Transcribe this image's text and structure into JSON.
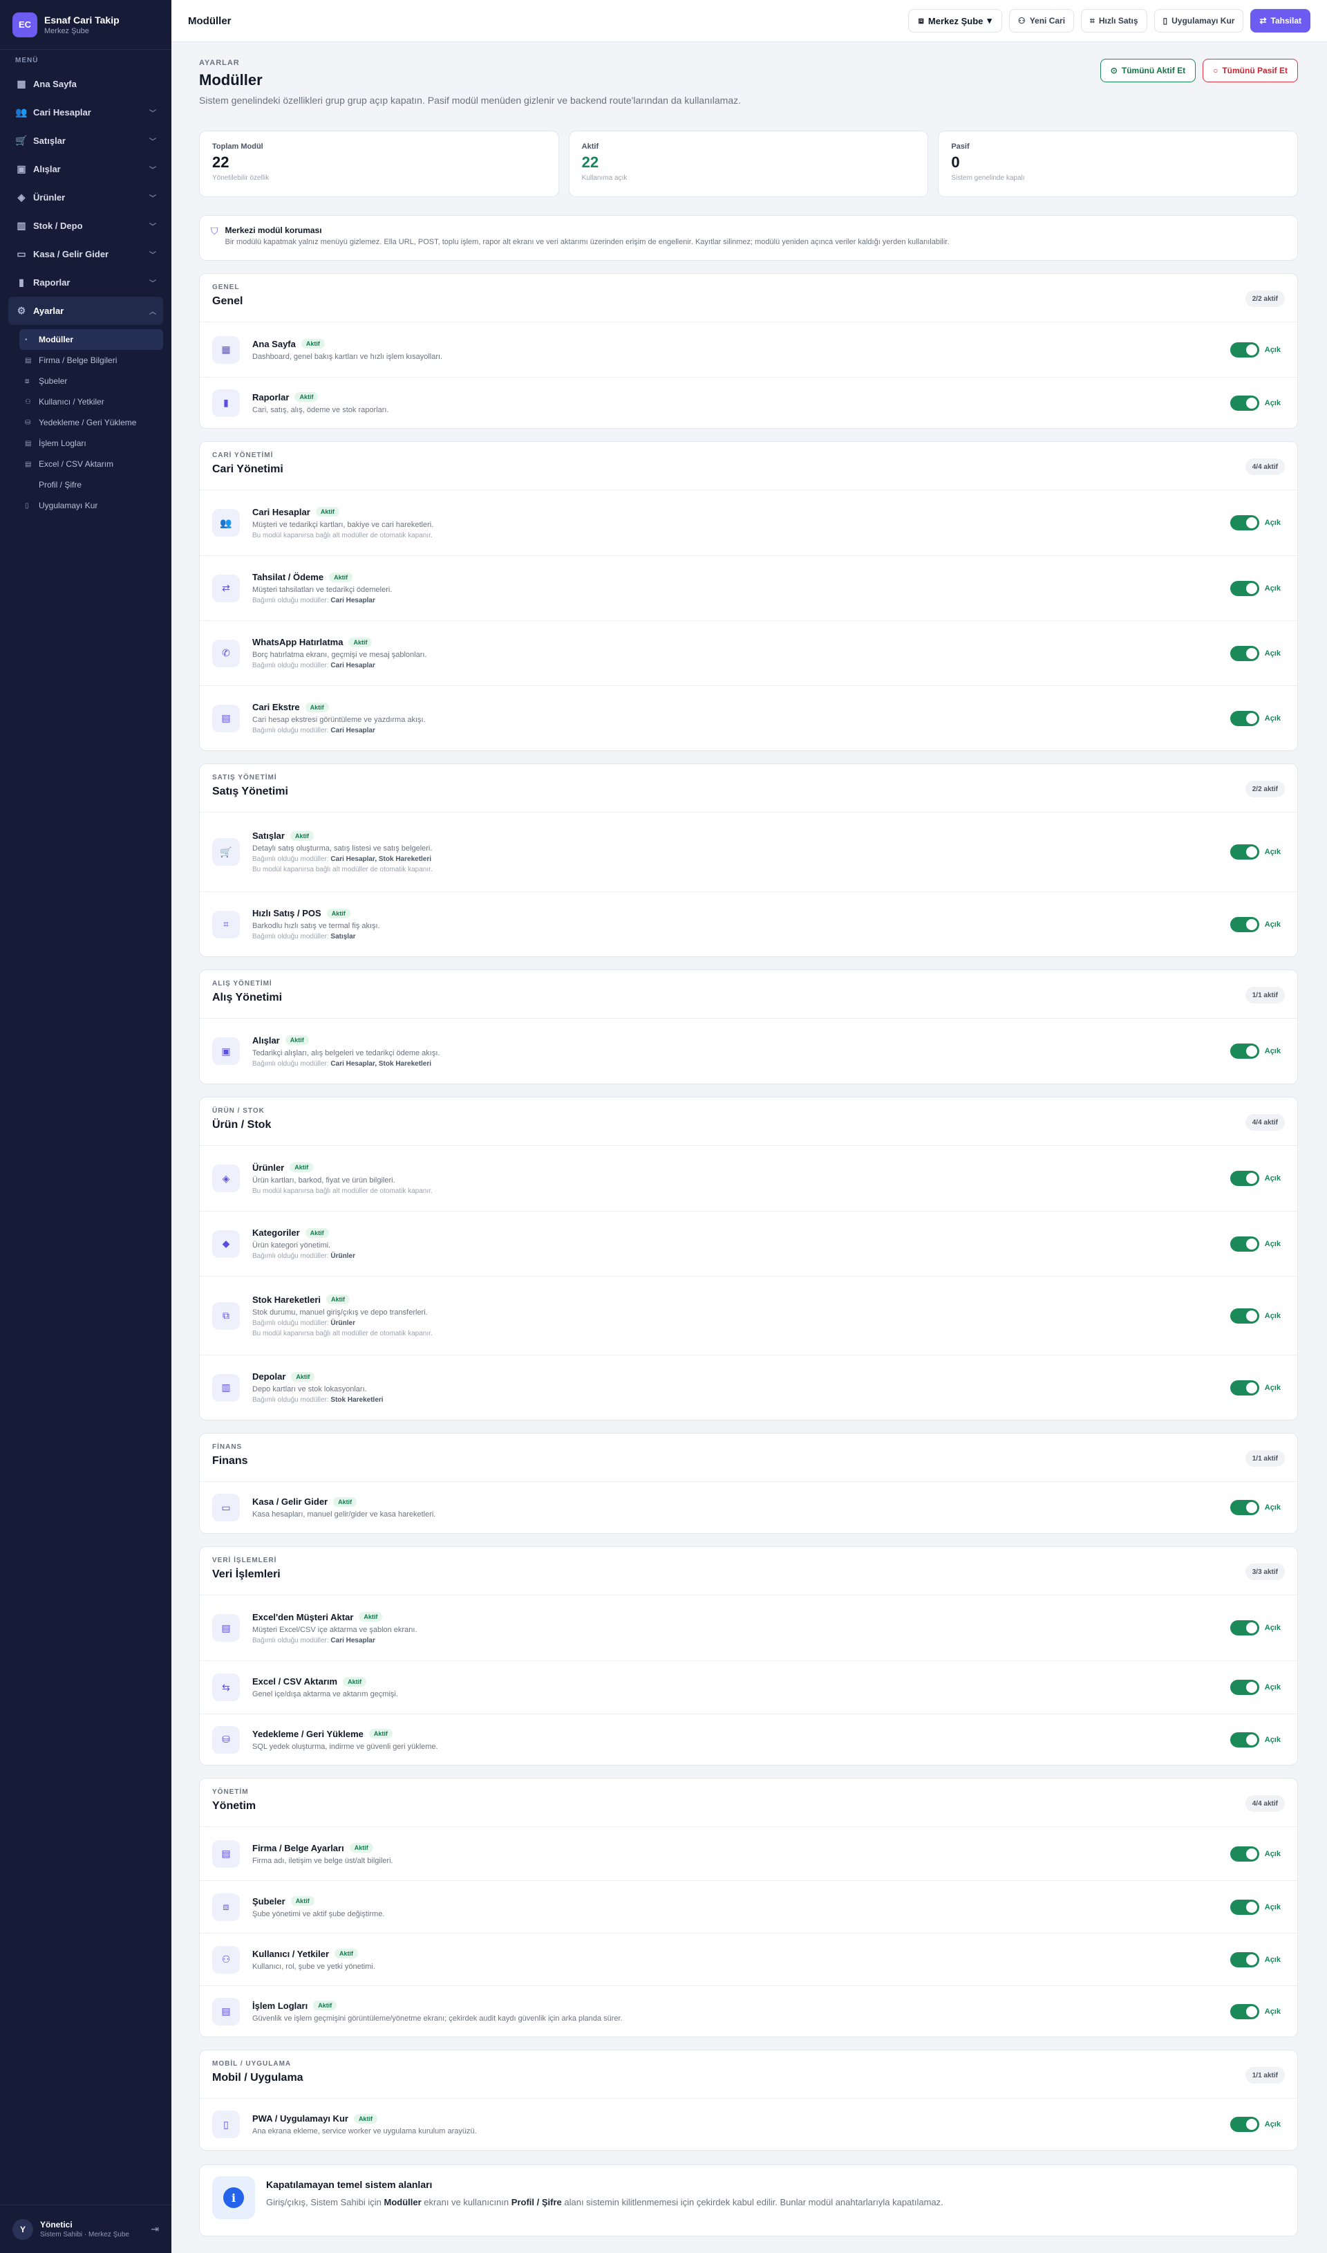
{
  "brand": {
    "logo": "EC",
    "name": "Esnaf Cari Takip",
    "sub": "Merkez Şube"
  },
  "sidebar": {
    "menu_title": "MENÜ",
    "items": [
      {
        "label": "Ana Sayfa",
        "icon": "home-icon"
      },
      {
        "label": "Cari Hesaplar",
        "icon": "users-icon"
      },
      {
        "label": "Satışlar",
        "icon": "cart-icon"
      },
      {
        "label": "Alışlar",
        "icon": "bag-icon"
      },
      {
        "label": "Ürünler",
        "icon": "box-icon"
      },
      {
        "label": "Stok / Depo",
        "icon": "warehouse-icon"
      },
      {
        "label": "Kasa / Gelir Gider",
        "icon": "wallet-icon"
      },
      {
        "label": "Raporlar",
        "icon": "chart-icon"
      },
      {
        "label": "Ayarlar",
        "icon": "gear-icon"
      }
    ],
    "sub_items": [
      "Modüller",
      "Firma / Belge Bilgileri",
      "Şubeler",
      "Kullanıcı / Yetkiler",
      "Yedekleme / Geri Yükleme",
      "İşlem Logları",
      "Excel / CSV Aktarım",
      "Profil / Şifre",
      "Uygulamayı Kur"
    ]
  },
  "user": {
    "avatar": "Y",
    "name": "Yönetici",
    "role": "Sistem Sahibi · Merkez Şube"
  },
  "topbar": {
    "title": "Modüller",
    "branch": "Merkez Şube",
    "new_cari": "Yeni Cari",
    "quick_sale": "Hızlı Satış",
    "install": "Uygulamayı Kur",
    "collect": "Tahsilat"
  },
  "page": {
    "eyebrow": "AYARLAR",
    "title": "Modüller",
    "desc": "Sistem genelindeki özellikleri grup grup açıp kapatın. Pasif modül menüden gizlenir ve backend route'larından da kullanılamaz.",
    "all_on": "Tümünü Aktif Et",
    "all_off": "Tümünü Pasif Et"
  },
  "stats": [
    {
      "label": "Toplam Modül",
      "value": "22",
      "sub": "Yönetilebilir özellik"
    },
    {
      "label": "Aktif",
      "value": "22",
      "sub": "Kullanıma açık"
    },
    {
      "label": "Pasif",
      "value": "0",
      "sub": "Sistem genelinde kapalı"
    }
  ],
  "notice": {
    "title": "Merkezi modül koruması",
    "text": "Bir modülü kapatmak yalnız menüyü gizlemez. Ella URL, POST, toplu işlem, rapor alt ekranı ve veri aktarımı üzerinden erişim de engellenir. Kayıtlar silinmez; modülü yeniden açınca veriler kaldığı yerden kullanılabilir."
  },
  "labels": {
    "active_pill": "Aktif",
    "on": "Açık",
    "dep_prefix": "Bağımlı olduğu modüller:"
  },
  "groups": [
    {
      "eyebrow": "GENEL",
      "title": "Genel",
      "badge": "2/2 aktif",
      "modules": [
        {
          "name": "Ana Sayfa",
          "icon": "dashboard-icon",
          "glyph": "▦",
          "desc": "Dashboard, genel bakış kartları ve hızlı işlem kısayolları.",
          "dep": "",
          "warn": "",
          "h": 79
        },
        {
          "name": "Raporlar",
          "icon": "chart-icon",
          "glyph": "▮",
          "desc": "Cari, satış, alış, ödeme ve stok raporları.",
          "dep": "",
          "warn": "",
          "h": 74
        }
      ]
    },
    {
      "eyebrow": "CARİ YÖNETİMİ",
      "title": "Cari Yönetimi",
      "badge": "4/4 aktif",
      "modules": [
        {
          "name": "Cari Hesaplar",
          "icon": "users-icon",
          "glyph": "👥",
          "desc": "Müşteri ve tedarikçi kartları, bakiye ve cari hareketleri.",
          "dep": "",
          "warn": "Bu modül kapanırsa bağlı alt modüller de otomatik kapanır.",
          "h": 94
        },
        {
          "name": "Tahsilat / Ödeme",
          "icon": "payment-icon",
          "glyph": "⇄",
          "desc": "Müşteri tahsilatları ve tedarikçi ödemeleri.",
          "dep": "Cari Hesaplar",
          "warn": "",
          "h": 94
        },
        {
          "name": "WhatsApp Hatırlatma",
          "icon": "whatsapp-icon",
          "glyph": "✆",
          "desc": "Borç hatırlatma ekranı, geçmişi ve mesaj şablonları.",
          "dep": "Cari Hesaplar",
          "warn": "",
          "h": 94
        },
        {
          "name": "Cari Ekstre",
          "icon": "document-icon",
          "glyph": "▤",
          "desc": "Cari hesap ekstresi görüntüleme ve yazdırma akışı.",
          "dep": "Cari Hesaplar",
          "warn": "",
          "h": 94
        }
      ]
    },
    {
      "eyebrow": "SATIŞ YÖNETİMİ",
      "title": "Satış Yönetimi",
      "badge": "2/2 aktif",
      "modules": [
        {
          "name": "Satışlar",
          "icon": "cart-icon",
          "glyph": "🛒",
          "desc": "Detaylı satış oluşturma, satış listesi ve satış belgeleri.",
          "dep": "Cari Hesaplar, Stok Hareketleri",
          "warn": "Bu modül kapanırsa bağlı alt modüller de otomatik kapanır.",
          "h": 114
        },
        {
          "name": "Hızlı Satış / POS",
          "icon": "barcode-icon",
          "glyph": "⌗",
          "desc": "Barkodlu hızlı satış ve termal fiş akışı.",
          "dep": "Satışlar",
          "warn": "",
          "h": 94
        }
      ]
    },
    {
      "eyebrow": "ALIŞ YÖNETİMİ",
      "title": "Alış Yönetimi",
      "badge": "1/1 aktif",
      "modules": [
        {
          "name": "Alışlar",
          "icon": "bag-icon",
          "glyph": "▣",
          "desc": "Tedarikçi alışları, alış belgeleri ve tedarikçi ödeme akışı.",
          "dep": "Cari Hesaplar, Stok Hareketleri",
          "warn": "",
          "h": 94
        }
      ]
    },
    {
      "eyebrow": "ÜRÜN / STOK",
      "title": "Ürün / Stok",
      "badge": "4/4 aktif",
      "modules": [
        {
          "name": "Ürünler",
          "icon": "box-icon",
          "glyph": "◈",
          "desc": "Ürün kartları, barkod, fiyat ve ürün bilgileri.",
          "dep": "",
          "warn": "Bu modül kapanırsa bağlı alt modüller de otomatik kapanır.",
          "h": 94
        },
        {
          "name": "Kategoriler",
          "icon": "tag-icon",
          "glyph": "◆",
          "desc": "Ürün kategori yönetimi.",
          "dep": "Ürünler",
          "warn": "",
          "h": 94
        },
        {
          "name": "Stok Hareketleri",
          "icon": "stock-icon",
          "glyph": "⧉",
          "desc": "Stok durumu, manuel giriş/çıkış ve depo transferleri.",
          "dep": "Ürünler",
          "warn": "Bu modül kapanırsa bağlı alt modüller de otomatik kapanır.",
          "h": 114
        },
        {
          "name": "Depolar",
          "icon": "warehouse-icon",
          "glyph": "▥",
          "desc": "Depo kartları ve stok lokasyonları.",
          "dep": "Stok Hareketleri",
          "warn": "",
          "h": 94
        }
      ]
    },
    {
      "eyebrow": "FİNANS",
      "title": "Finans",
      "badge": "1/1 aktif",
      "modules": [
        {
          "name": "Kasa / Gelir Gider",
          "icon": "wallet-icon",
          "glyph": "▭",
          "desc": "Kasa hesapları, manuel gelir/gider ve kasa hareketleri.",
          "dep": "",
          "warn": "",
          "h": 74
        }
      ]
    },
    {
      "eyebrow": "VERİ İŞLEMLERİ",
      "title": "Veri İşlemleri",
      "badge": "3/3 aktif",
      "modules": [
        {
          "name": "Excel'den Müşteri Aktar",
          "icon": "file-icon",
          "glyph": "▤",
          "desc": "Müşteri Excel/CSV içe aktarma ve şablon ekranı.",
          "dep": "Cari Hesaplar",
          "warn": "",
          "h": 94
        },
        {
          "name": "Excel / CSV Aktarım",
          "icon": "transfer-icon",
          "glyph": "⇆",
          "desc": "Genel içe/dışa aktarma ve aktarım geçmişi.",
          "dep": "",
          "warn": "",
          "h": 77
        },
        {
          "name": "Yedekleme / Geri Yükleme",
          "icon": "database-icon",
          "glyph": "⛁",
          "desc": "SQL yedek oluşturma, indirme ve güvenli geri yükleme.",
          "dep": "",
          "warn": "",
          "h": 74
        }
      ]
    },
    {
      "eyebrow": "YÖNETİM",
      "title": "Yönetim",
      "badge": "4/4 aktif",
      "modules": [
        {
          "name": "Firma / Belge Ayarları",
          "icon": "company-icon",
          "glyph": "▤",
          "desc": "Firma adı, iletişim ve belge üst/alt bilgileri.",
          "dep": "",
          "warn": "",
          "h": 77
        },
        {
          "name": "Şubeler",
          "icon": "branch-icon",
          "glyph": "⧈",
          "desc": "Şube yönetimi ve aktif şube değiştirme.",
          "dep": "",
          "warn": "",
          "h": 76
        },
        {
          "name": "Kullanıcı / Yetkiler",
          "icon": "user-key-icon",
          "glyph": "⚇",
          "desc": "Kullanıcı, rol, şube ve yetki yönetimi.",
          "dep": "",
          "warn": "",
          "h": 76
        },
        {
          "name": "İşlem Logları",
          "icon": "log-icon",
          "glyph": "▤",
          "desc": "Güvenlik ve işlem geçmişini görüntüleme/yönetme ekranı; çekirdek audit kaydı güvenlik için arka planda sürer.",
          "dep": "",
          "warn": "",
          "h": 74
        }
      ]
    },
    {
      "eyebrow": "MOBİL / UYGULAMA",
      "title": "Mobil / Uygulama",
      "badge": "1/1 aktif",
      "modules": [
        {
          "name": "PWA / Uygulamayı Kur",
          "icon": "mobile-icon",
          "glyph": "▯",
          "desc": "Ana ekrana ekleme, service worker ve uygulama kurulum arayüzü.",
          "dep": "",
          "warn": "",
          "h": 74
        }
      ]
    }
  ],
  "footer_info": {
    "title": "Kapatılamayan temel sistem alanları",
    "text_a": "Giriş/çıkış, Sistem Sahibi için",
    "bold_a": "Modüller",
    "text_b": "ekranı ve kullanıcının",
    "bold_b": "Profil / Şifre",
    "text_c": "alanı sistemin kilitlenmemesi için çekirdek kabul edilir. Bunlar modül anahtarlarıyla kapatılamaz."
  }
}
